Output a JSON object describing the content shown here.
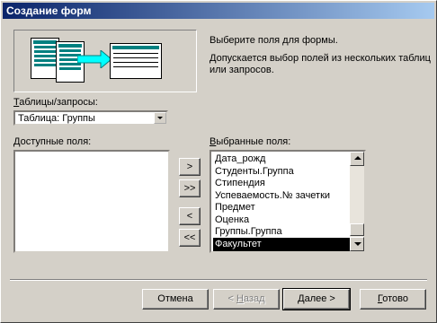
{
  "window": {
    "title": "Создание форм"
  },
  "instructions": {
    "line1": "Выберите поля для формы.",
    "line2": "Допускается выбор полей из нескольких таблиц",
    "line3": "или запросов."
  },
  "tables_queries": {
    "label_prefix": "Т",
    "label_rest": "аблицы/запросы:",
    "selected": "Таблица: Группы"
  },
  "available_fields": {
    "label_prefix": "Д",
    "label_rest": "оступные поля:",
    "items": []
  },
  "selected_fields": {
    "label_prefix": "В",
    "label_rest": "ыбранные поля:",
    "items": [
      "Дата_рожд",
      "Студенты.Группа",
      "Стипендия",
      "Успеваемость.№ зачетки",
      "Предмет",
      "Оценка",
      "Группы.Группа",
      "Факультет"
    ],
    "selected_index": 7
  },
  "move_buttons": {
    "add_one": ">",
    "add_all": ">>",
    "remove_one": "<",
    "remove_all": "<<"
  },
  "footer": {
    "cancel": "Отмена",
    "back_prefix": "< ",
    "back_hot": "Н",
    "back_rest": "азад",
    "next_hot": "Д",
    "next_rest": "алее >",
    "finish_hot": "Г",
    "finish_rest": "отово"
  },
  "colors": {
    "titlebar_start": "#0a246a",
    "titlebar_end": "#a6caf0",
    "illustration_teal": "#008080",
    "arrow_cyan": "#00ffff"
  }
}
